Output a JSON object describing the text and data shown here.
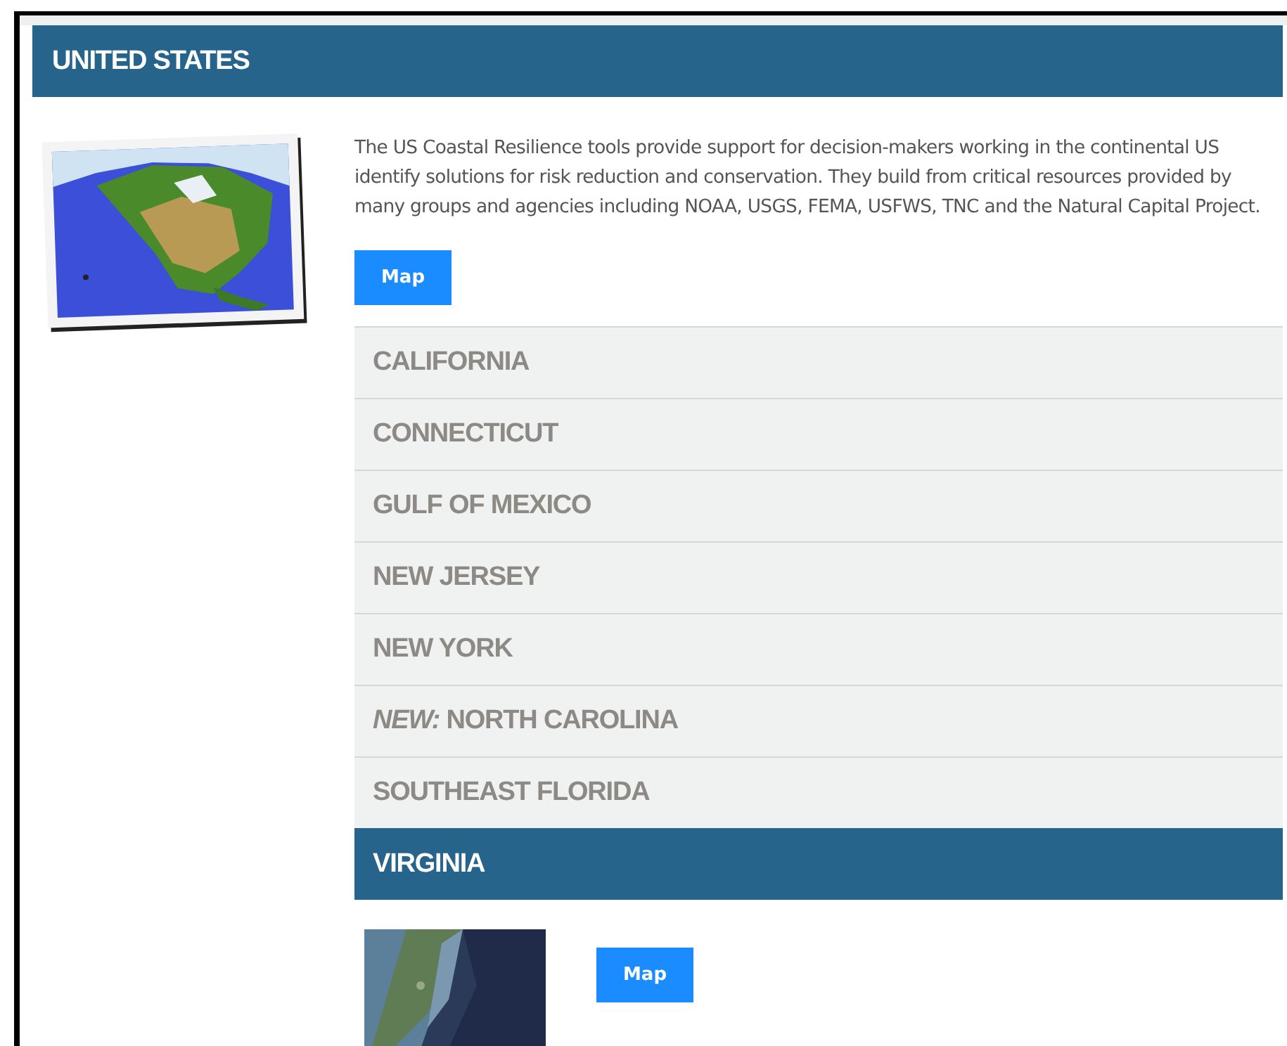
{
  "section": {
    "title": "UNITED STATES",
    "description": "The US Coastal Resilience tools provide support for decision-makers working in the continental US identify solutions for risk reduction and conservation. They build from critical resources provided by many groups and agencies including NOAA, USGS, FEMA, USFWS, TNC and the Natural Capital Project.",
    "button": "Map"
  },
  "regions": [
    {
      "label": "CALIFORNIA",
      "selected": false
    },
    {
      "label": "CONNECTICUT",
      "selected": false
    },
    {
      "label": "GULF OF MEXICO",
      "selected": false
    },
    {
      "label": "NEW JERSEY",
      "selected": false
    },
    {
      "label": "NEW YORK",
      "selected": false
    },
    {
      "label": "*NEW:* NORTH CAROLINA",
      "selected": false
    },
    {
      "label": "SOUTHEAST FLORIDA",
      "selected": false
    },
    {
      "label": "VIRGINIA",
      "selected": true
    }
  ],
  "expanded_region": {
    "button": "Map"
  }
}
